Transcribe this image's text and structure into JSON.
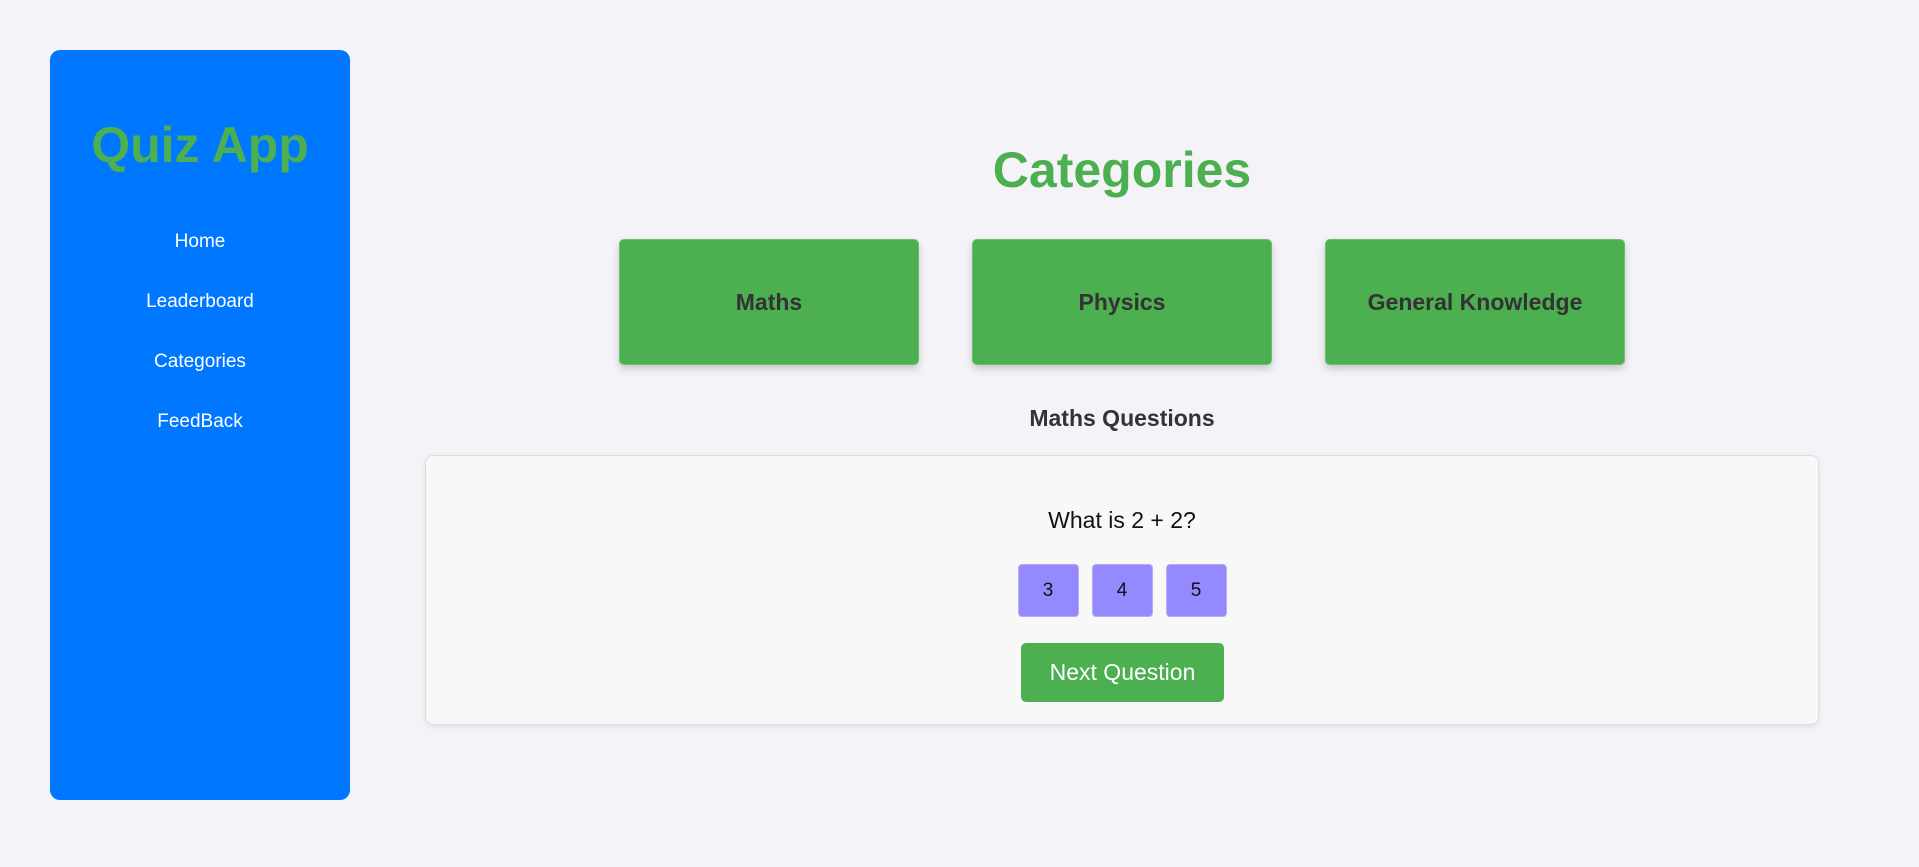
{
  "sidebar": {
    "title": "Quiz App",
    "items": [
      {
        "label": "Home"
      },
      {
        "label": "Leaderboard"
      },
      {
        "label": "Categories"
      },
      {
        "label": "FeedBack"
      }
    ]
  },
  "main": {
    "title": "Categories",
    "categories": [
      {
        "label": "Maths"
      },
      {
        "label": "Physics"
      },
      {
        "label": "General Knowledge"
      }
    ],
    "section_title": "Maths Questions",
    "question": {
      "text": "What is 2 + 2?",
      "options": [
        "3",
        "4",
        "5"
      ]
    },
    "next_button_label": "Next Question"
  },
  "colors": {
    "sidebar_bg": "#0077ff",
    "accent_green": "#4caf50",
    "option_purple": "#9489ff",
    "page_bg": "#f4f3f8"
  }
}
